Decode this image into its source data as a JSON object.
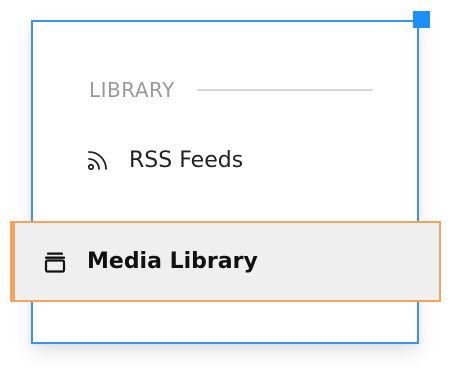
{
  "panel": {
    "section_title": "LIBRARY",
    "items": [
      {
        "label": "RSS Feeds",
        "icon": "rss-icon",
        "active": false
      },
      {
        "label": "Media Library",
        "icon": "media-library-icon",
        "active": true
      }
    ]
  },
  "colors": {
    "selection_border": "#3d94e6",
    "handle": "#1e8ff5",
    "active_highlight_border": "#f0a460",
    "active_background": "#efefef"
  }
}
